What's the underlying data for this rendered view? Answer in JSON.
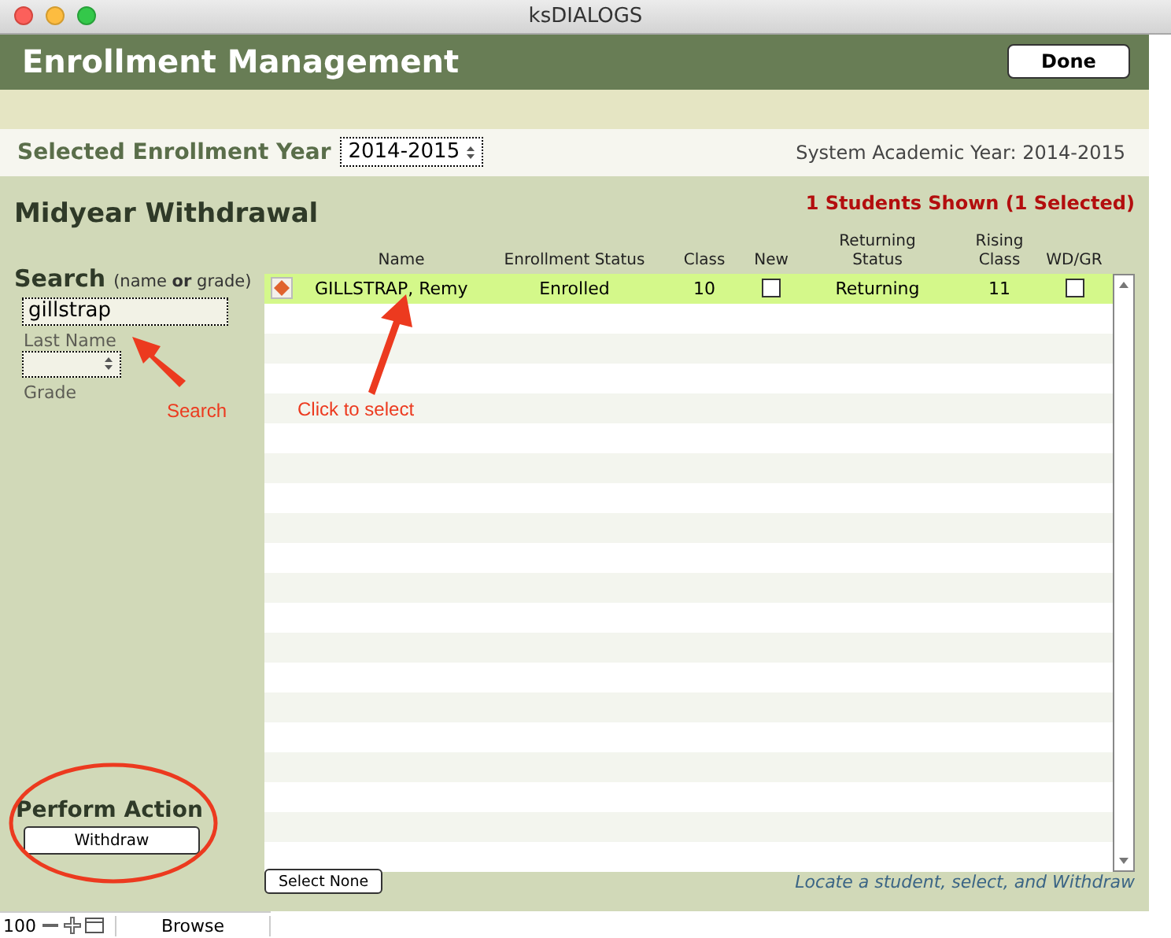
{
  "window": {
    "title": "ksDIALOGS"
  },
  "header": {
    "title": "Enrollment Management",
    "done_button": "Done"
  },
  "year_bar": {
    "label": "Selected Enrollment Year",
    "year_select": "2014-2015",
    "system_year": "System Academic Year: 2014-2015"
  },
  "panel": {
    "title": "Midyear Withdrawal",
    "count": "1 Students Shown (1 Selected)"
  },
  "search": {
    "title": "Search",
    "hint": "(name **or** grade)",
    "last_name_value": "gillstrap",
    "last_name_label": "Last Name",
    "grade_label": "Grade"
  },
  "table": {
    "columns": [
      "Name",
      "Enrollment Status",
      "Class",
      "New",
      "Returning Status",
      "Rising Class",
      "WD/GR"
    ],
    "rows": [
      {
        "name": "GILLSTRAP, Remy",
        "enrollment_status": "Enrolled",
        "class": "10",
        "new": false,
        "returning_status": "Returning",
        "rising_class": "11",
        "wd_gr": false,
        "selected": true
      }
    ]
  },
  "action": {
    "title": "Perform Action",
    "button": "Withdraw"
  },
  "select_none_button": "Select None",
  "footer_hint": "Locate a student, select, and Withdraw",
  "annotations": [
    {
      "kind": "search",
      "text": "Search"
    },
    {
      "kind": "select",
      "text": "Click to select"
    }
  ],
  "status_bar": {
    "zoom": "100",
    "mode": "Browse"
  }
}
